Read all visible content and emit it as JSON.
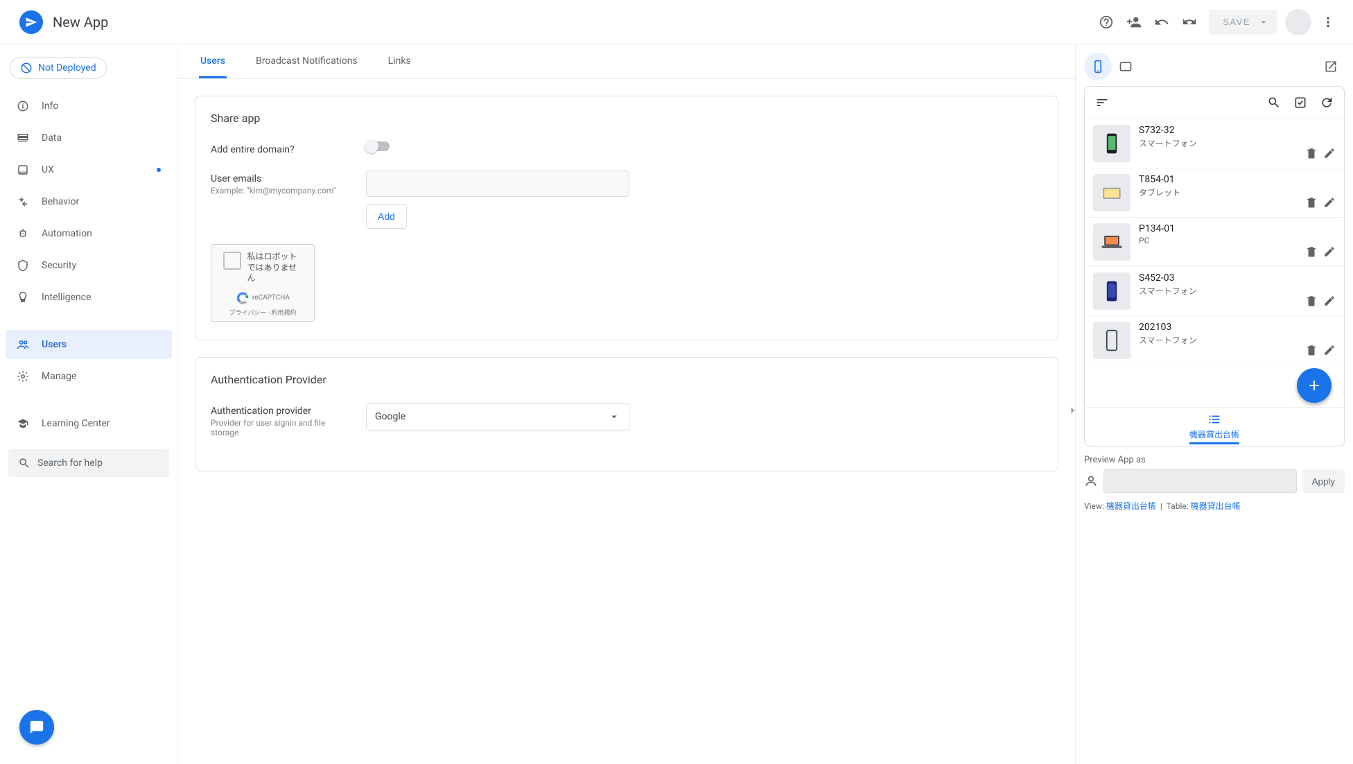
{
  "header": {
    "title": "New App",
    "save": "SAVE"
  },
  "sidebar": {
    "deploy_status": "Not Deployed",
    "items": [
      {
        "label": "Info"
      },
      {
        "label": "Data"
      },
      {
        "label": "UX",
        "dot": true
      },
      {
        "label": "Behavior"
      },
      {
        "label": "Automation"
      },
      {
        "label": "Security"
      },
      {
        "label": "Intelligence"
      },
      {
        "label": "Users",
        "active": true
      },
      {
        "label": "Manage"
      },
      {
        "label": "Learning Center"
      }
    ],
    "search_placeholder": "Search for help"
  },
  "tabs": [
    {
      "label": "Users",
      "active": true
    },
    {
      "label": "Broadcast Notifications"
    },
    {
      "label": "Links"
    }
  ],
  "share_card": {
    "title": "Share app",
    "add_domain_label": "Add entire domain?",
    "emails_label": "User emails",
    "emails_hint": "Example: \"kim@mycompany.com\"",
    "add_button": "Add",
    "recaptcha_text": "私はロボットではありません",
    "recaptcha_brand": "reCAPTCHA",
    "recaptcha_links": "プライバシー - 利用規約"
  },
  "auth_card": {
    "title": "Authentication Provider",
    "label": "Authentication provider",
    "hint": "Provider for user signin and file storage",
    "value": "Google"
  },
  "preview": {
    "list": [
      {
        "title": "S732-32",
        "sub": "スマートフォン",
        "kind": "phone-dark"
      },
      {
        "title": "T854-01",
        "sub": "タブレット",
        "kind": "tablet"
      },
      {
        "title": "P134-01",
        "sub": "PC",
        "kind": "laptop"
      },
      {
        "title": "S452-03",
        "sub": "スマートフォン",
        "kind": "phone-blue"
      },
      {
        "title": "202103",
        "sub": "スマートフォン",
        "kind": "phone-outline"
      }
    ],
    "bottom_tab": "機器貸出台帳",
    "preview_as_label": "Preview App as",
    "apply": "Apply",
    "view_label": "View:",
    "view_value": "機器貸出台帳",
    "table_label": "Table:",
    "table_value": "機器貸出台帳"
  }
}
